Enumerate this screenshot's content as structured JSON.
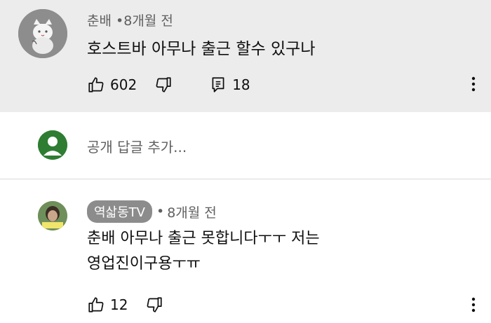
{
  "top_comment": {
    "author": "춘배",
    "separator": "•",
    "time": "8개월 전",
    "text": "호스트바 아무나 출근 할수 있구나",
    "likes": "602",
    "replies": "18"
  },
  "reply_box": {
    "placeholder": "공개 답글 추가..."
  },
  "reply_comment": {
    "author": "역삷동TV",
    "separator": "•",
    "time": "8개월 전",
    "text_line1": "춘배 아무나 출근 못합니다ㅜㅜ 저는",
    "text_line2": "영업진이구용ㅜㅠ",
    "likes": "12"
  },
  "icons": {
    "like": "thumbs-up-icon",
    "dislike": "thumbs-down-icon",
    "reply": "comment-icon",
    "more": "more-vert-icon"
  },
  "colors": {
    "highlight_bg": "#ececec",
    "meta_text": "#606060",
    "author_chip": "#8c8c8c"
  }
}
